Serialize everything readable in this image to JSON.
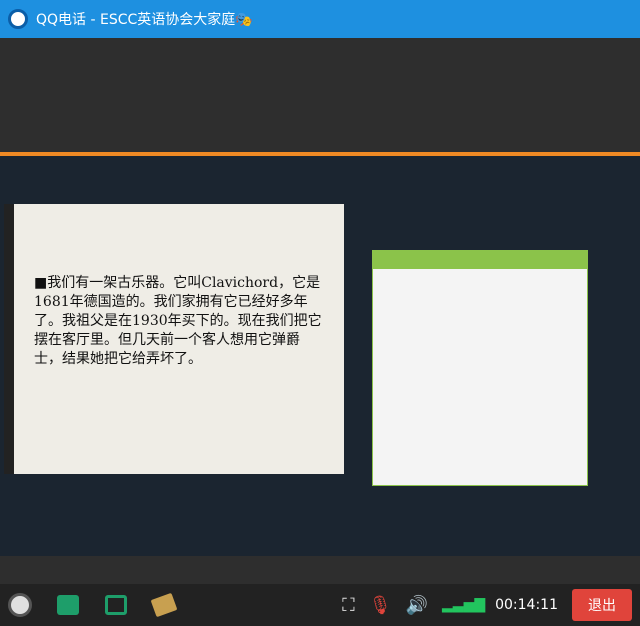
{
  "window": {
    "title": "QQ电话 - ESCC英语协会大家庭🎭"
  },
  "slide": {
    "text": "■我们有一架古乐器。它叫Clavichord，它是1681年德国造的。我们家拥有它已经好多年了。我祖父是在1930年买下的。现在我们把它摆在客厅里。但几天前一个客人想用它弹爵士，结果她把它给弄坏了。"
  },
  "controls": {
    "timer": "00:14:11",
    "exit_label": "退出",
    "icons": [
      "camera-icon",
      "stats-icon",
      "screen-share-icon",
      "whiteboard-icon",
      "fullscreen-icon",
      "mic-off-icon",
      "speaker-icon",
      "signal-icon"
    ]
  }
}
